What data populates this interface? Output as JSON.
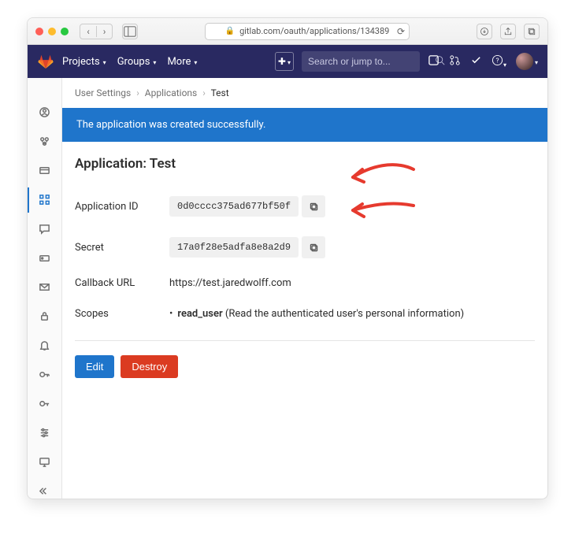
{
  "browser": {
    "url": "gitlab.com/oauth/applications/134389"
  },
  "header": {
    "nav": {
      "projects": "Projects",
      "groups": "Groups",
      "more": "More"
    },
    "search_placeholder": "Search or jump to..."
  },
  "breadcrumb": {
    "a": "User Settings",
    "b": "Applications",
    "c": "Test"
  },
  "flash": "The application was created successfully.",
  "page": {
    "title_prefix": "Application: ",
    "title_name": "Test",
    "labels": {
      "app_id": "Application ID",
      "secret": "Secret",
      "callback": "Callback URL",
      "scopes": "Scopes"
    },
    "values": {
      "app_id": "0d0cccc375ad677bf50f",
      "secret": "17a0f28e5adfa8e8a2d9",
      "callback": "https://test.jaredwolff.com",
      "scope_name": "read_user",
      "scope_desc": " (Read the authenticated user's personal information)"
    },
    "buttons": {
      "edit": "Edit",
      "destroy": "Destroy"
    }
  }
}
